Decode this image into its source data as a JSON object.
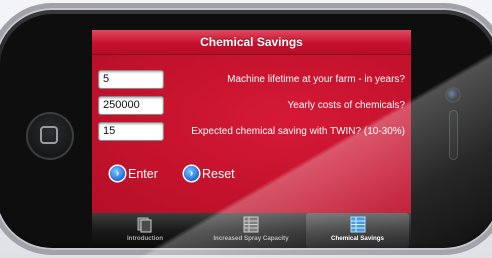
{
  "screen": {
    "title": "Chemical Savings"
  },
  "form": {
    "fields": [
      {
        "value": "5",
        "label": "Machine lifetime at your farm - in years?"
      },
      {
        "value": "250000",
        "label": "Yearly costs of chemicals?"
      },
      {
        "value": "15",
        "label": "Expected chemical saving with TWIN? (10-30%)"
      }
    ],
    "enter_label": "Enter",
    "reset_label": "Reset"
  },
  "tabs": [
    {
      "label": "Introduction",
      "icon": "document-icon",
      "selected": false
    },
    {
      "label": "Increased Spray Capacity",
      "icon": "spreadsheet-icon",
      "selected": false
    },
    {
      "label": "Chemical Savings",
      "icon": "spreadsheet-icon",
      "selected": true
    }
  ],
  "colors": {
    "accent": "#c8102e",
    "button_icon": "#1c6fd4",
    "tab_selected_icon": "#5ab4ff"
  }
}
